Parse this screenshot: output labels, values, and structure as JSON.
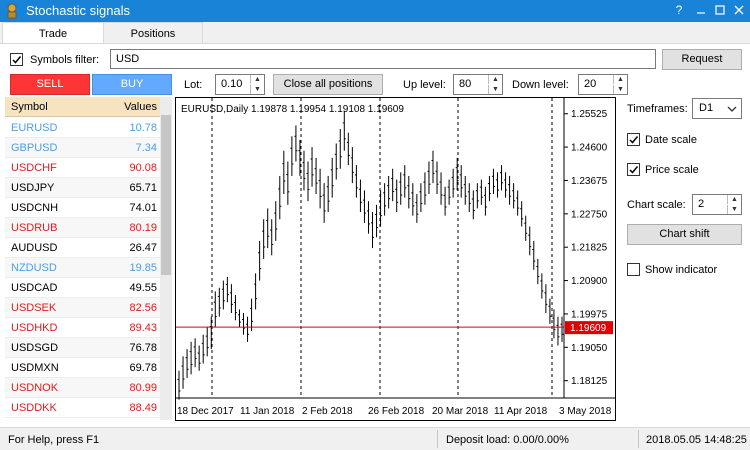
{
  "window": {
    "title": "Stochastic signals"
  },
  "tabs": [
    {
      "label": "Trade"
    },
    {
      "label": "Positions"
    }
  ],
  "filter": {
    "label": "Symbols filter:",
    "value": "USD",
    "checked": true,
    "request_label": "Request"
  },
  "trade": {
    "sell_label": "SELL",
    "buy_label": "BUY",
    "lot_label": "Lot:",
    "lot_value": "0.10",
    "close_all_label": "Close all positions",
    "up_label": "Up level:",
    "up_value": "80",
    "down_label": "Down level:",
    "down_value": "20"
  },
  "colors": {
    "sell": "#ff3535",
    "buy": "#63a9ff",
    "red": "#e21b1b",
    "blue": "#4b9ee8"
  },
  "table": {
    "headers": {
      "symbol": "Symbol",
      "values": "Values"
    },
    "rows": [
      {
        "symbol": "EURUSD",
        "value": "10.78",
        "color": "blue"
      },
      {
        "symbol": "GBPUSD",
        "value": "7.34",
        "color": "blue"
      },
      {
        "symbol": "USDCHF",
        "value": "90.08",
        "color": "red"
      },
      {
        "symbol": "USDJPY",
        "value": "65.71",
        "color": "black"
      },
      {
        "symbol": "USDCNH",
        "value": "74.01",
        "color": "black"
      },
      {
        "symbol": "USDRUB",
        "value": "80.19",
        "color": "red"
      },
      {
        "symbol": "AUDUSD",
        "value": "26.47",
        "color": "black"
      },
      {
        "symbol": "NZDUSD",
        "value": "19.85",
        "color": "blue"
      },
      {
        "symbol": "USDCAD",
        "value": "49.55",
        "color": "black"
      },
      {
        "symbol": "USDSEK",
        "value": "82.56",
        "color": "red"
      },
      {
        "symbol": "USDHKD",
        "value": "89.43",
        "color": "red"
      },
      {
        "symbol": "USDSGD",
        "value": "76.78",
        "color": "black"
      },
      {
        "symbol": "USDMXN",
        "value": "69.78",
        "color": "black"
      },
      {
        "symbol": "USDNOK",
        "value": "80.99",
        "color": "red"
      },
      {
        "symbol": "USDDKK",
        "value": "88.49",
        "color": "red"
      }
    ]
  },
  "chart": {
    "header": "EURUSD,Daily  1.19878 1.19954 1.19108 1.19609",
    "price_labels": [
      "1.25525",
      "1.24600",
      "1.23675",
      "1.22750",
      "1.21825",
      "1.20900",
      "1.19975",
      "1.19050",
      "1.18125"
    ],
    "current_price": "1.19609",
    "date_labels": [
      "18 Dec 2017",
      "11 Jan 2018",
      "2 Feb 2018",
      "26 Feb 2018",
      "20 Mar 2018",
      "11 Apr 2018",
      "3 May 2018"
    ]
  },
  "chart_data": {
    "type": "bar",
    "title": "EURUSD,Daily",
    "ylim": [
      1.177,
      1.2585
    ],
    "bars": [
      [
        1.176,
        1.184
      ],
      [
        1.179,
        1.188
      ],
      [
        1.182,
        1.19
      ],
      [
        1.183,
        1.192
      ],
      [
        1.185,
        1.193
      ],
      [
        1.184,
        1.191
      ],
      [
        1.186,
        1.194
      ],
      [
        1.188,
        1.196
      ],
      [
        1.19,
        1.199
      ],
      [
        1.196,
        1.206
      ],
      [
        1.199,
        1.207
      ],
      [
        1.201,
        1.209
      ],
      [
        1.203,
        1.21
      ],
      [
        1.2,
        1.208
      ],
      [
        1.198,
        1.205
      ],
      [
        1.196,
        1.201
      ],
      [
        1.194,
        1.2
      ],
      [
        1.192,
        1.199
      ],
      [
        1.195,
        1.204
      ],
      [
        1.201,
        1.211
      ],
      [
        1.209,
        1.22
      ],
      [
        1.215,
        1.226
      ],
      [
        1.218,
        1.229
      ],
      [
        1.216,
        1.226
      ],
      [
        1.22,
        1.231
      ],
      [
        1.226,
        1.238
      ],
      [
        1.233,
        1.245
      ],
      [
        1.23,
        1.242
      ],
      [
        1.238,
        1.249
      ],
      [
        1.242,
        1.252
      ],
      [
        1.238,
        1.248
      ],
      [
        1.234,
        1.245
      ],
      [
        1.231,
        1.242
      ],
      [
        1.235,
        1.246
      ],
      [
        1.233,
        1.243
      ],
      [
        1.229,
        1.24
      ],
      [
        1.225,
        1.236
      ],
      [
        1.228,
        1.238
      ],
      [
        1.232,
        1.243
      ],
      [
        1.237,
        1.247
      ],
      [
        1.24,
        1.251
      ],
      [
        1.245,
        1.256
      ],
      [
        1.241,
        1.25
      ],
      [
        1.236,
        1.246
      ],
      [
        1.232,
        1.241
      ],
      [
        1.228,
        1.237
      ],
      [
        1.225,
        1.234
      ],
      [
        1.222,
        1.231
      ],
      [
        1.218,
        1.228
      ],
      [
        1.221,
        1.23
      ],
      [
        1.224,
        1.234
      ],
      [
        1.227,
        1.236
      ],
      [
        1.229,
        1.238
      ],
      [
        1.231,
        1.24
      ],
      [
        1.228,
        1.237
      ],
      [
        1.23,
        1.239
      ],
      [
        1.232,
        1.241
      ],
      [
        1.229,
        1.238
      ],
      [
        1.227,
        1.236
      ],
      [
        1.225,
        1.233
      ],
      [
        1.228,
        1.236
      ],
      [
        1.23,
        1.239
      ],
      [
        1.233,
        1.242
      ],
      [
        1.236,
        1.245
      ],
      [
        1.233,
        1.242
      ],
      [
        1.23,
        1.239
      ],
      [
        1.227,
        1.235
      ],
      [
        1.23,
        1.237
      ],
      [
        1.232,
        1.24
      ],
      [
        1.234,
        1.243
      ],
      [
        1.232,
        1.241
      ],
      [
        1.23,
        1.238
      ],
      [
        1.228,
        1.236
      ],
      [
        1.226,
        1.234
      ],
      [
        1.229,
        1.236
      ],
      [
        1.23,
        1.237
      ],
      [
        1.227,
        1.235
      ],
      [
        1.231,
        1.238
      ],
      [
        1.233,
        1.24
      ],
      [
        1.232,
        1.239
      ],
      [
        1.234,
        1.241
      ],
      [
        1.232,
        1.239
      ],
      [
        1.23,
        1.238
      ],
      [
        1.229,
        1.236
      ],
      [
        1.227,
        1.234
      ],
      [
        1.224,
        1.231
      ],
      [
        1.22,
        1.227
      ],
      [
        1.216,
        1.224
      ],
      [
        1.212,
        1.22
      ],
      [
        1.208,
        1.215
      ],
      [
        1.204,
        1.211
      ],
      [
        1.2,
        1.208
      ],
      [
        1.197,
        1.204
      ],
      [
        1.193,
        1.201
      ],
      [
        1.191,
        1.199
      ],
      [
        1.192,
        1.199
      ]
    ],
    "current": 1.19609
  },
  "side": {
    "timeframes_label": "Timeframes:",
    "timeframe_value": "D1",
    "date_scale_label": "Date scale",
    "date_scale_checked": true,
    "price_scale_label": "Price scale",
    "price_scale_checked": true,
    "chart_scale_label": "Chart scale:",
    "chart_scale_value": "2",
    "chart_shift_label": "Chart shift",
    "show_indicator_label": "Show indicator",
    "show_indicator_checked": false
  },
  "status": {
    "help": "For Help, press F1",
    "deposit": "Deposit load: 0.00/0.00%",
    "time": "2018.05.05 14:48:25"
  }
}
